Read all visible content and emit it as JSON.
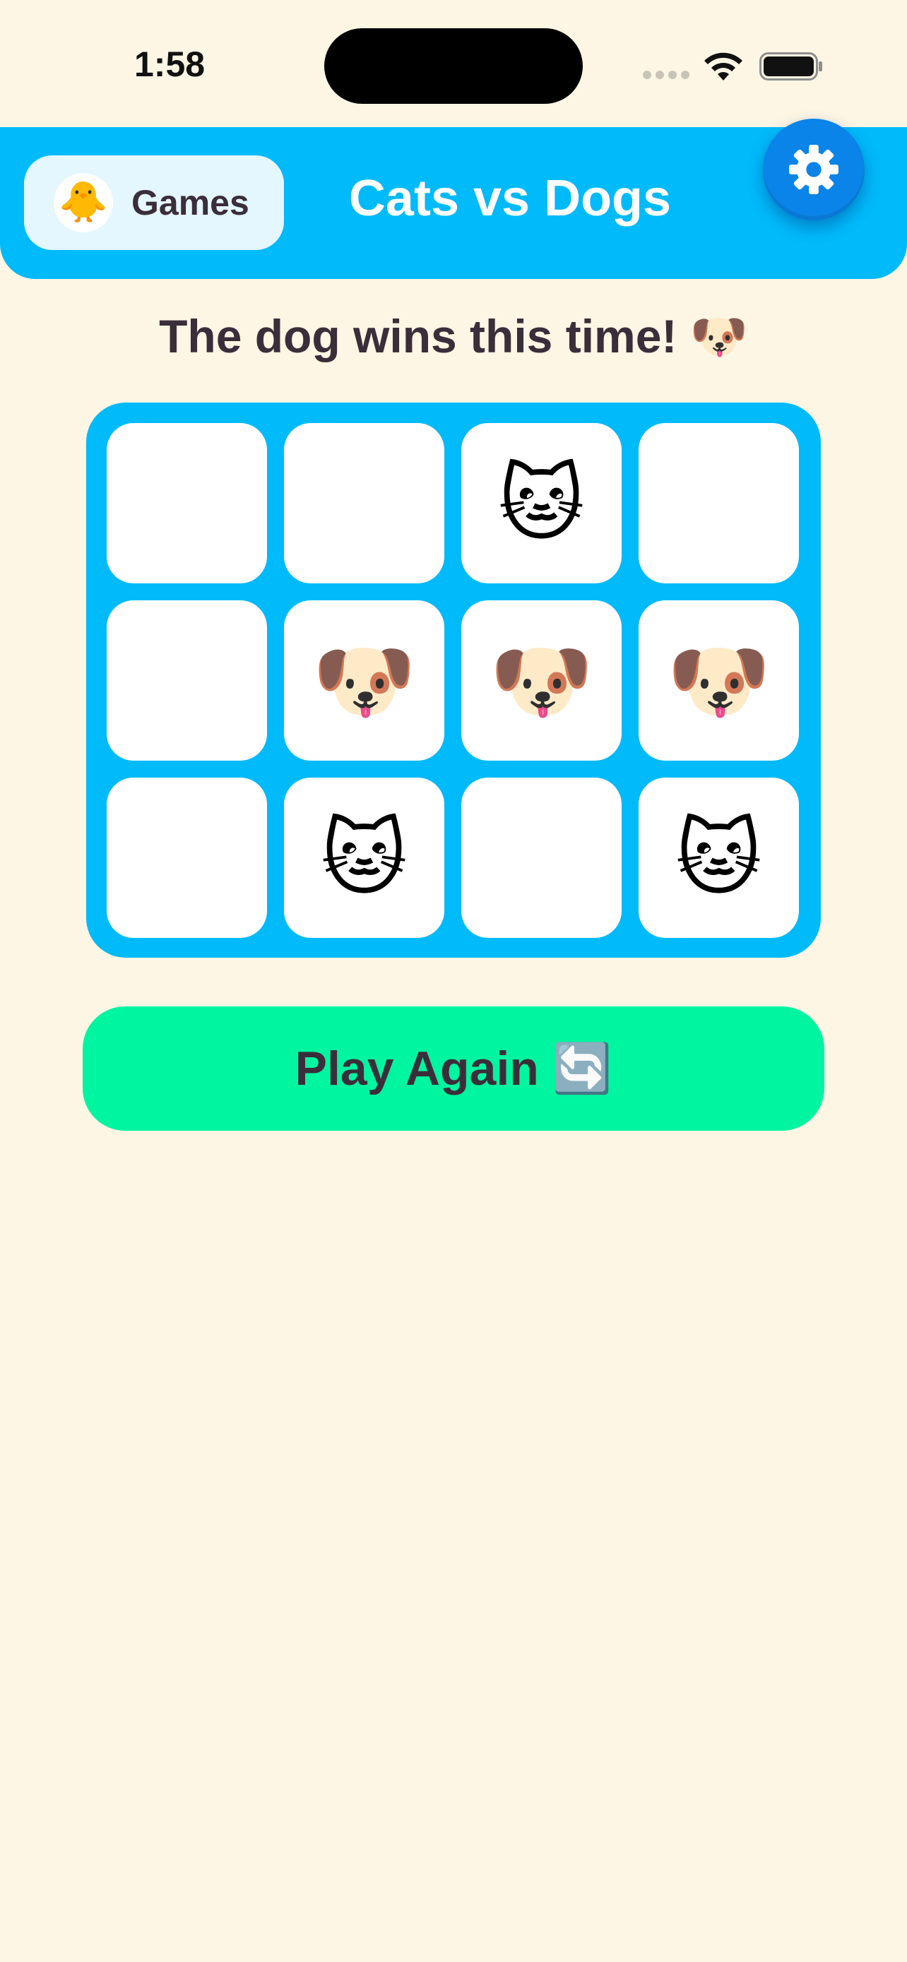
{
  "status_bar": {
    "time": "1:58"
  },
  "header": {
    "games_button_label": "Games",
    "games_avatar_emoji": "🐥",
    "title": "Cats vs Dogs",
    "settings_icon": "gear-icon"
  },
  "result": {
    "message": "The dog wins this time! 🐶"
  },
  "board": {
    "rows": 3,
    "cols": 4,
    "cells": [
      "",
      "",
      "🐱",
      "",
      "",
      "🐶",
      "🐶",
      "🐶",
      "",
      "🐱",
      "",
      "🐱"
    ]
  },
  "actions": {
    "play_again_label": "Play Again 🔄"
  },
  "colors": {
    "background": "#FDF6E4",
    "header": "#00BAFA",
    "board": "#00BAFA",
    "play_again": "#00F5A0",
    "settings_button": "#0A84E8",
    "text_dark": "#3A2E3A"
  }
}
